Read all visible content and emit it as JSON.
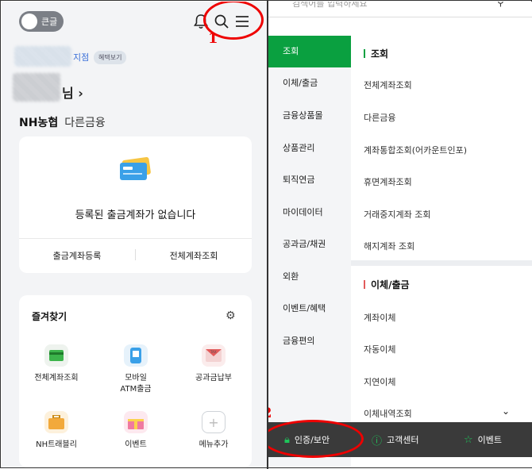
{
  "left": {
    "toggle_label": "큰글",
    "branch_suffix": "지점",
    "benefit_badge": "혜택보기",
    "name_suffix": "님 ›",
    "tab_primary": "NH농협",
    "tab_secondary": "다른금융",
    "empty_message": "등록된 출금계좌가 없습니다",
    "btn_register": "출금계좌등록",
    "btn_view_all": "전체계좌조회",
    "favorites_title": "즐겨찾기",
    "quick_items": [
      {
        "label": "전체계좌조회",
        "icon": "account-card-icon"
      },
      {
        "label": "모바일\nATM출금",
        "icon": "mobile-atm-icon"
      },
      {
        "label": "공과금납부",
        "icon": "tax-bill-icon"
      },
      {
        "label": "NH트래블리",
        "icon": "suitcase-icon"
      },
      {
        "label": "이벤트",
        "icon": "gift-icon"
      },
      {
        "label": "메뉴추가",
        "icon": "add-menu-icon"
      }
    ],
    "annotation_1": "1",
    "annotation_2": "2"
  },
  "right": {
    "search_placeholder": "검색어를 입력하세요",
    "categories": [
      "조회",
      "이체/출금",
      "금융상품몰",
      "상품관리",
      "퇴직연금",
      "마이데이터",
      "공과금/채권",
      "외환",
      "이벤트/혜택",
      "금융편의"
    ],
    "active_category": "조회",
    "section1": {
      "title": "조회",
      "items": [
        "전체계좌조회",
        "다른금융",
        "계좌통합조회(어카운트인포)",
        "휴면계좌조회",
        "거래중지계좌 조회",
        "해지계좌 조회"
      ]
    },
    "section2": {
      "title": "이체/출금",
      "items": [
        "계좌이체",
        "자동이체",
        "지연이체",
        "이체내역조회"
      ]
    },
    "bottom_bar": [
      {
        "label": "인증/보안",
        "icon": "lock-icon"
      },
      {
        "label": "고객센터",
        "icon": "info-icon"
      },
      {
        "label": "이벤트",
        "icon": "star-icon"
      }
    ]
  },
  "colors": {
    "accent_green": "#0aa040",
    "annotation_red": "#e00000"
  }
}
